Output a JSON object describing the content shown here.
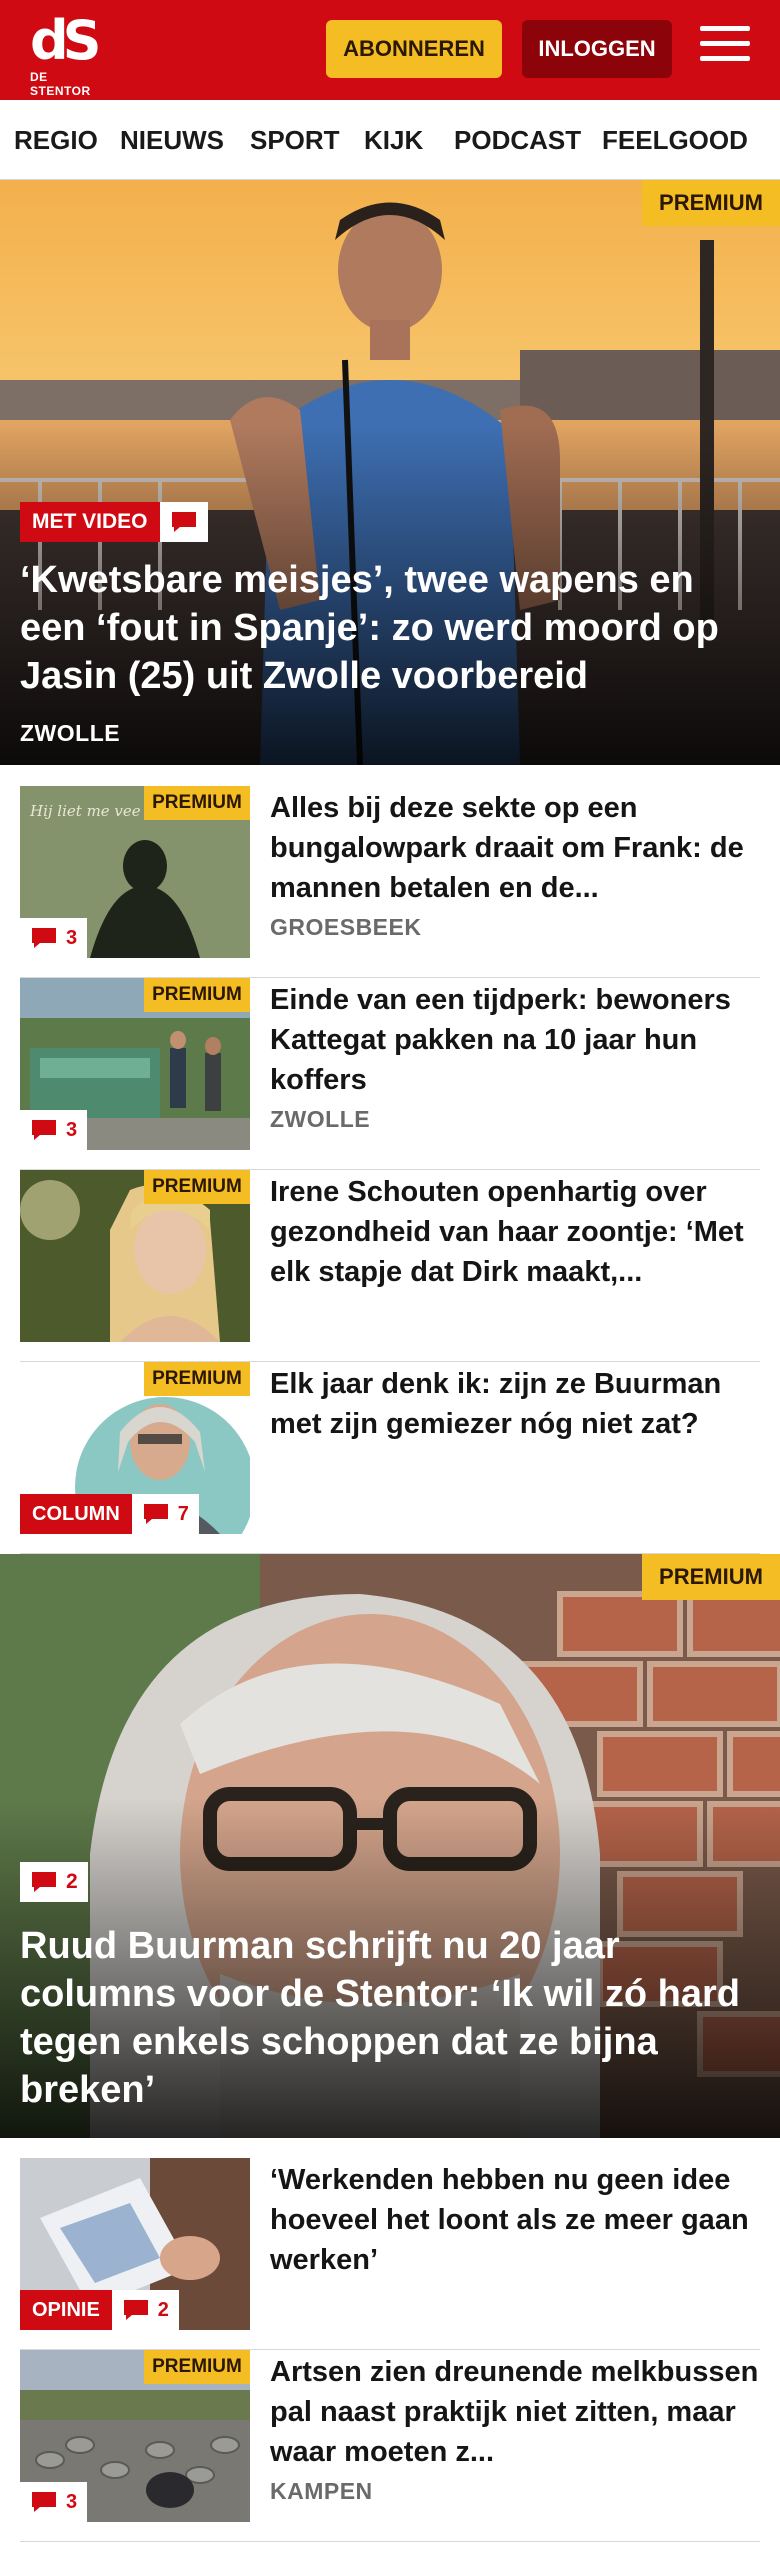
{
  "header": {
    "logo_mark": "dS",
    "logo_name": "DE STENTOR",
    "subscribe_label": "ABONNEREN",
    "login_label": "INLOGGEN",
    "brand_color": "#cf0a12",
    "accent_color": "#f5bd24"
  },
  "nav": {
    "items": [
      "REGIO",
      "NIEUWS",
      "SPORT",
      "KIJK",
      "PODCAST",
      "FEELGOOD"
    ]
  },
  "hero1": {
    "premium": "PREMIUM",
    "label": "MET VIDEO",
    "title": "‘Kwetsbare meisjes’, twee wapens en een ‘fout in Spanje’: zo werd moord op Jasin (25) uit Zwolle voorbereid",
    "location": "ZWOLLE"
  },
  "articles": [
    {
      "premium": "PREMIUM",
      "comments": "3",
      "title": "Alles bij deze sekte op een bungalowpark draait om Frank: de mannen betalen en de...",
      "location": "GROESBEEK",
      "thumb_text": "Hij liet me vee"
    },
    {
      "premium": "PREMIUM",
      "comments": "3",
      "title": "Einde van een tijdperk: bewoners Kattegat pakken na 10 jaar hun koffers",
      "location": "ZWOLLE"
    },
    {
      "premium": "PREMIUM",
      "title": "Irene Schouten openhartig over gezondheid van haar zoontje: ‘Met elk stapje dat Dirk maakt,..."
    },
    {
      "premium": "PREMIUM",
      "label": "COLUMN",
      "comments": "7",
      "title": "Elk jaar denk ik: zijn ze Buurman met zijn gemiezer nóg niet zat?"
    }
  ],
  "hero2": {
    "premium": "PREMIUM",
    "comments": "2",
    "title": "Ruud Buurman schrijft nu 20 jaar columns voor de Stentor: ‘Ik wil zó hard tegen enkels schoppen dat ze bijna breken’"
  },
  "articles2": [
    {
      "label": "OPINIE",
      "comments": "2",
      "title": "‘Werkenden hebben nu geen idee hoeveel het loont als ze meer gaan werken’"
    },
    {
      "premium": "PREMIUM",
      "comments": "3",
      "title": "Artsen zien dreunende melkbussen pal naast praktijk niet zitten, maar waar moeten z...",
      "location": "KAMPEN"
    }
  ]
}
